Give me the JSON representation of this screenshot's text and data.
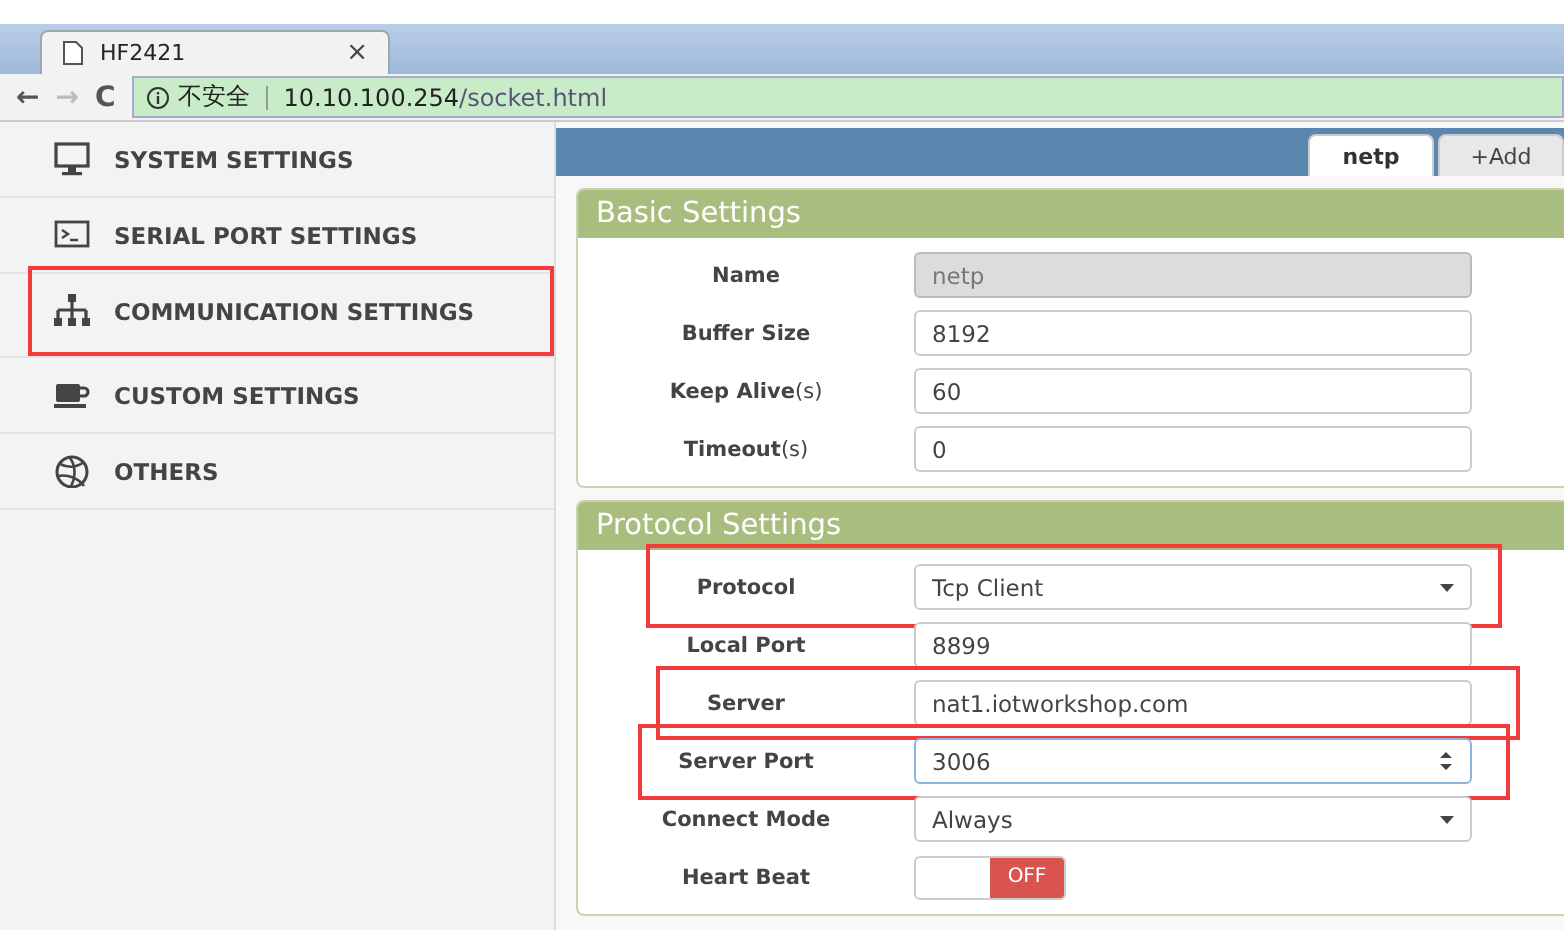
{
  "browser": {
    "tab_title": "HF2421",
    "close": "×",
    "nav": {
      "back": "←",
      "forward": "→",
      "reload": "C"
    },
    "security": "不安全",
    "url_host": "10.10.100.254",
    "url_path": "/socket.html"
  },
  "sidebar": {
    "items": [
      {
        "label": "SYSTEM SETTINGS",
        "highlighted": false
      },
      {
        "label": "SERIAL PORT SETTINGS",
        "highlighted": false
      },
      {
        "label": "COMMUNICATION SETTINGS",
        "highlighted": true
      },
      {
        "label": "CUSTOM SETTINGS",
        "highlighted": false
      },
      {
        "label": "OTHERS",
        "highlighted": false
      }
    ]
  },
  "tabs": [
    {
      "label": "netp",
      "selected": true
    },
    {
      "label": "+Add",
      "selected": false
    }
  ],
  "sections": [
    {
      "title": "Basic Settings",
      "fields": [
        {
          "kind": "text",
          "label": "Name",
          "value": "netp",
          "disabled": true,
          "highlighted": false
        },
        {
          "kind": "text",
          "label": "Buffer Size",
          "value": "8192",
          "disabled": false,
          "highlighted": false
        },
        {
          "kind": "text",
          "label": "Keep Alive",
          "unit": "(s)",
          "value": "60",
          "disabled": false,
          "highlighted": false
        },
        {
          "kind": "text",
          "label": "Timeout",
          "unit": "(s)",
          "value": "0",
          "disabled": false,
          "highlighted": false
        }
      ]
    },
    {
      "title": "Protocol Settings",
      "fields": [
        {
          "kind": "select",
          "label": "Protocol",
          "value": "Tcp Client",
          "disabled": false,
          "highlighted": true
        },
        {
          "kind": "text",
          "label": "Local Port",
          "value": "8899",
          "disabled": false,
          "highlighted": false
        },
        {
          "kind": "text",
          "label": "Server",
          "value": "nat1.iotworkshop.com",
          "disabled": false,
          "highlighted": true
        },
        {
          "kind": "number",
          "label": "Server Port",
          "value": "3006",
          "disabled": false,
          "highlighted": true
        },
        {
          "kind": "select",
          "label": "Connect Mode",
          "value": "Always",
          "disabled": false,
          "highlighted": false
        },
        {
          "kind": "toggle",
          "label": "Heart Beat",
          "value": "OFF",
          "on": false,
          "disabled": false,
          "highlighted": false
        }
      ]
    }
  ]
}
